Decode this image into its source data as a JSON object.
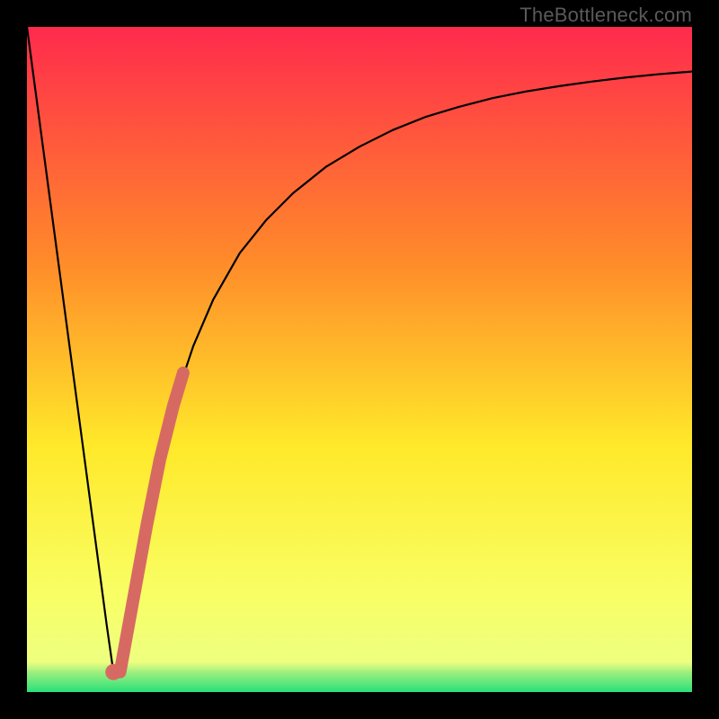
{
  "watermark": "TheBottleneck.com",
  "colors": {
    "frame": "#000000",
    "grad_top": "#ff2a4d",
    "grad_mid1": "#ff8a2a",
    "grad_mid2": "#ffe92a",
    "grad_low": "#f8ff66",
    "grad_green": "#29e07a",
    "curve": "#000000",
    "highlight": "#d66a63"
  },
  "chart_data": {
    "type": "line",
    "title": "",
    "xlabel": "",
    "ylabel": "",
    "xlim": [
      0,
      100
    ],
    "ylim": [
      0,
      100
    ],
    "series": [
      {
        "name": "bottleneck-curve",
        "x": [
          0,
          2,
          4,
          6,
          8,
          10,
          12,
          13,
          14,
          16,
          18,
          20,
          22,
          25,
          28,
          32,
          36,
          40,
          45,
          50,
          55,
          60,
          65,
          70,
          75,
          80,
          85,
          90,
          95,
          100
        ],
        "y": [
          100,
          85,
          70,
          55,
          40,
          25,
          10,
          3,
          3,
          14,
          25,
          35,
          43,
          52,
          59,
          66,
          71,
          75,
          79,
          82,
          84.5,
          86.5,
          88,
          89.3,
          90.3,
          91.1,
          91.8,
          92.4,
          92.9,
          93.3
        ]
      }
    ],
    "highlight_segment": {
      "name": "emphasis",
      "x": [
        13,
        14,
        16,
        18,
        20,
        22,
        23.5
      ],
      "y": [
        3,
        3,
        14,
        25,
        35,
        43,
        48
      ]
    }
  }
}
